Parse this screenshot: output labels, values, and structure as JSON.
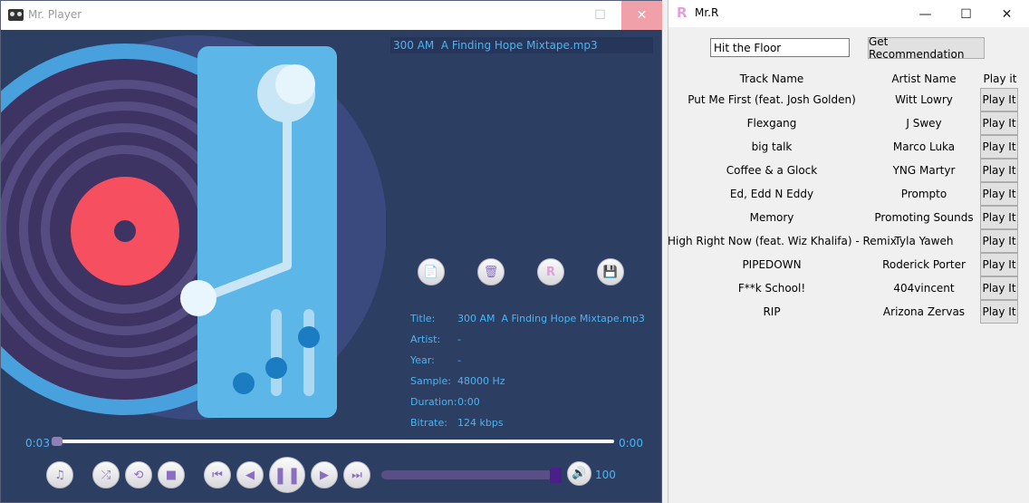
{
  "player": {
    "window_title": "Mr. Player",
    "controls": {
      "close": "✕",
      "maximize": "☐"
    },
    "now_playing": "300 AM  A Finding Hope Mixtape.mp3",
    "info": [
      {
        "label": "Title:",
        "value": "300 AM  A Finding Hope Mixtape.mp3"
      },
      {
        "label": "Artist:",
        "value": "-"
      },
      {
        "label": "Year:",
        "value": "-"
      },
      {
        "label": "Sample:",
        "value": "48000 Hz"
      },
      {
        "label": "Duration:",
        "value": "0:00"
      },
      {
        "label": "Bitrate:",
        "value": "124 kbps"
      }
    ],
    "time_elapsed": "0:03",
    "time_total": "0:00",
    "volume": "100",
    "icons": {
      "add_file": "add-file-icon",
      "delete": "delete-icon",
      "recommend": "recommend-icon",
      "save": "save-icon",
      "playlist": "playlist-icon",
      "shuffle": "shuffle-icon",
      "repeat": "repeat-icon",
      "stop": "stop-icon",
      "skip_back": "skip-back-icon",
      "rewind": "rewind-icon",
      "pause": "pause-icon",
      "forward": "fast-forward-icon",
      "skip_forward": "skip-forward-icon",
      "volume": "volume-icon"
    },
    "colors": {
      "background": "#2d3e63",
      "accent": "#4db4f0",
      "record_label": "#f64f5f"
    }
  },
  "recommender": {
    "window_title": "Mr.R",
    "controls": {
      "minimize": "—",
      "maximize": "☐",
      "close": "✕"
    },
    "search_value": "Hit the Floor",
    "get_button": "Get Recommendation",
    "headers": {
      "track": "Track Name",
      "artist": "Artist Name",
      "play": "Play it"
    },
    "play_label": "Play It",
    "rows": [
      {
        "track": "Put Me First (feat. Josh Golden)",
        "artist": "Witt Lowry"
      },
      {
        "track": "Flexgang",
        "artist": "J Swey"
      },
      {
        "track": "big talk",
        "artist": "Marco Luka"
      },
      {
        "track": "Coffee & a Glock",
        "artist": "YNG Martyr"
      },
      {
        "track": "Ed, Edd N Eddy",
        "artist": "Prompto"
      },
      {
        "track": "Memory",
        "artist": "Promoting Sounds"
      },
      {
        "track": "High Right Now (feat. Wiz Khalifa) - Remix",
        "artist": "Tyla Yaweh"
      },
      {
        "track": "PIPEDOWN",
        "artist": "Roderick Porter"
      },
      {
        "track": "F**k School!",
        "artist": "404vincent"
      },
      {
        "track": "RIP",
        "artist": "Arizona Zervas"
      }
    ]
  }
}
